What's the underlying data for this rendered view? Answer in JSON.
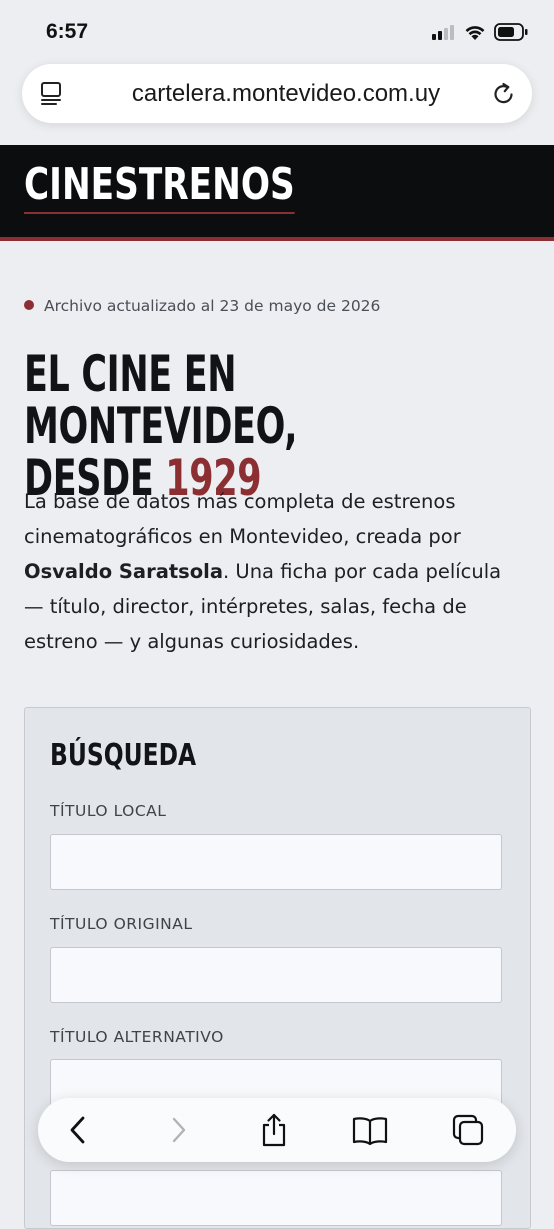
{
  "status_bar": {
    "time": "6:57"
  },
  "browser": {
    "url": "cartelera.montevideo.com.uy"
  },
  "site": {
    "logo": "CINESTRENOS",
    "accent_color": "#8c2f33"
  },
  "page": {
    "updated_text": "Archivo actualizado al 23 de mayo de 2026",
    "title_line1": "EL CINE EN MONTEVIDEO,",
    "title_line2_prefix": "DESDE ",
    "title_year": "1929",
    "intro_part1": "La base de datos más completa de estrenos cinematográficos en Montevideo, creada por ",
    "intro_author": "Osvaldo Saratsola",
    "intro_part2": ". Una ficha por cada película — título, director, intérpretes, salas, fecha de estreno — y algunas curiosidades."
  },
  "search": {
    "heading": "BÚSQUEDA",
    "fields": [
      {
        "label": "TÍTULO LOCAL",
        "value": ""
      },
      {
        "label": "TÍTULO ORIGINAL",
        "value": ""
      },
      {
        "label": "TÍTULO ALTERNATIVO",
        "value": ""
      }
    ]
  },
  "toolbar": {
    "icons": [
      "back-icon",
      "forward-icon",
      "share-icon",
      "bookmarks-icon",
      "tabs-icon"
    ]
  }
}
